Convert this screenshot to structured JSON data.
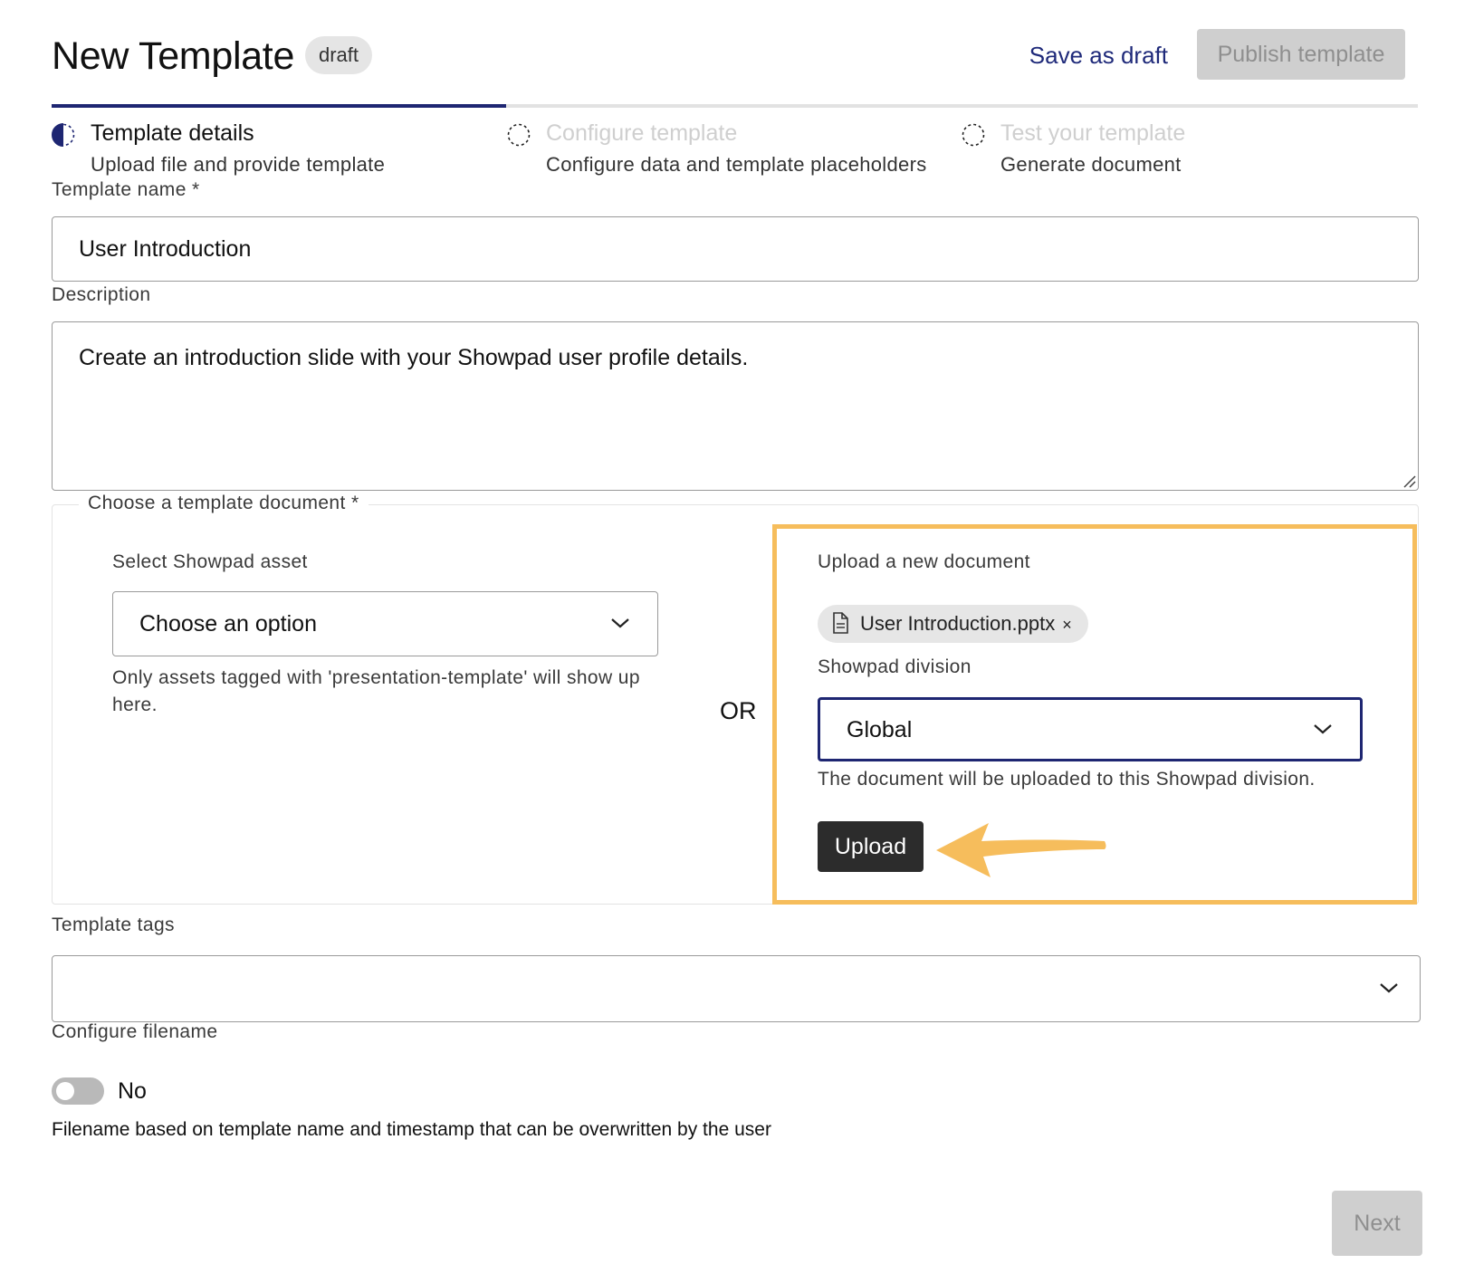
{
  "header": {
    "title": "New Template",
    "status_badge": "draft",
    "save_draft_label": "Save as draft",
    "publish_label": "Publish template"
  },
  "stepper": {
    "progress": 0.333,
    "steps": [
      {
        "title": "Template details",
        "subtitle": "Upload file and provide template",
        "state": "active"
      },
      {
        "title": "Configure template",
        "subtitle": "Configure data and template placeholders",
        "state": "inactive"
      },
      {
        "title": "Test your template",
        "subtitle": "Generate document",
        "state": "inactive"
      }
    ]
  },
  "form": {
    "name_label": "Template name *",
    "name_value": "User Introduction",
    "description_label": "Description",
    "description_value": "Create an introduction slide with your Showpad user profile details.",
    "document": {
      "legend": "Choose a template document *",
      "asset_label": "Select Showpad asset",
      "asset_select_value": "Choose an option",
      "asset_hint": "Only assets tagged with 'presentation-template' will show up here.",
      "or_text": "OR",
      "upload_label": "Upload a new document",
      "file_chip": "User Introduction.pptx",
      "chip_remove": "×",
      "division_label": "Showpad division",
      "division_value": "Global",
      "division_hint": "The document will be uploaded to this Showpad division.",
      "upload_button": "Upload"
    },
    "tags_label": "Template tags",
    "tags_value": "",
    "filename_label": "Configure filename",
    "filename_toggle": "No",
    "filename_hint": "Filename based on template name and timestamp that can be overwritten by the user"
  },
  "footer": {
    "next_label": "Next"
  },
  "colors": {
    "accent": "#1e2672",
    "highlight": "#f6bd5c",
    "disabled_bg": "#cfcfcf",
    "upload_button_bg": "#2c2c2c"
  },
  "icons": {
    "step_active": "half-filled-circle-icon",
    "step_inactive": "dashed-circle-icon",
    "dropdown": "chevron-down-icon",
    "file": "document-icon",
    "annotation": "arrow-icon"
  }
}
